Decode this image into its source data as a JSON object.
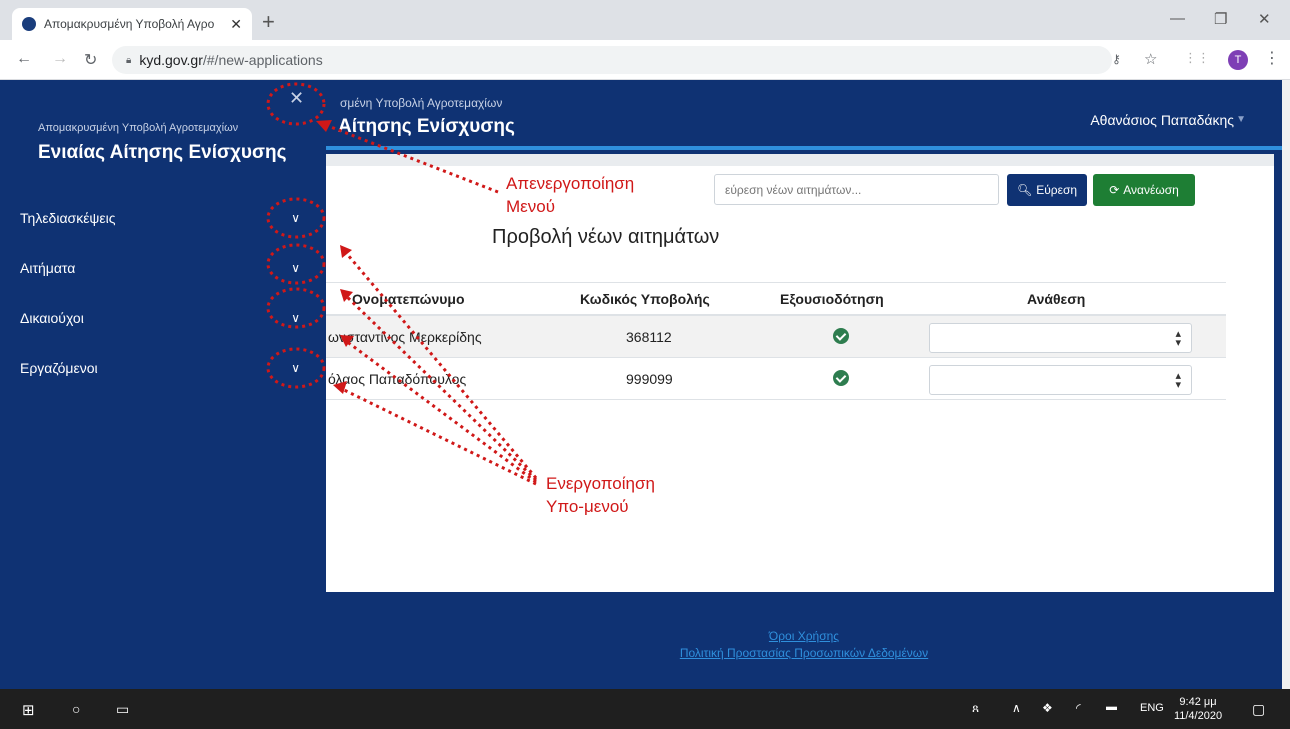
{
  "browser": {
    "tab_title": "Απομακρυσμένη Υποβολή Αγρο",
    "tab_close": "✕",
    "new_tab": "+",
    "url_domain": "kyd.gov.gr",
    "url_path": "/#/new-applications",
    "profile_initial": "T"
  },
  "sidebar": {
    "small_title": "Απομακρυσμένη Υποβολή Αγροτεμαχίων",
    "big_title": "Ενιαίας Αίτησης Ενίσχυσης",
    "close": "✕",
    "items": [
      {
        "label": "Τηλεδιασκέψεις"
      },
      {
        "label": "Αιτήματα"
      },
      {
        "label": "Δικαιούχοι"
      },
      {
        "label": "Εργαζόμενοι"
      }
    ]
  },
  "header": {
    "small_title": "σμένη Υποβολή Αγροτεμαχίων",
    "big_title": "Αίτησης Ενίσχυσης",
    "user": "Αθανάσιος Παπαδάκης"
  },
  "main": {
    "search_placeholder": "εύρεση νέων αιτημάτων...",
    "search_button": "Εύρεση",
    "refresh_button": "Ανανέωση",
    "title": "Προβολή νέων αιτημάτων",
    "columns": [
      "Ονοματεπώνυμο",
      "Κωδικός Υποβολής",
      "Εξουσιοδότηση",
      "Ανάθεση"
    ],
    "rows": [
      {
        "name": "ωνσταντίνος Μερκερίδης",
        "code": "368112",
        "authorized": true
      },
      {
        "name": "όλαος Παπαδόπουλος",
        "code": "999099",
        "authorized": true
      }
    ]
  },
  "footer": {
    "terms": "Όροι Χρήσης",
    "privacy": "Πολιτική Προστασίας Προσωπικών Δεδομένων"
  },
  "annotations": {
    "deactivate_line1": "Απενεργοποίηση",
    "deactivate_line2": "Μενού",
    "activate_line1": "Ενεργοποίηση",
    "activate_line2": "Υπο-μενού",
    "color": "#d01818"
  },
  "taskbar": {
    "lang": "ENG",
    "time": "9:42 μμ",
    "date": "11/4/2020"
  },
  "colors": {
    "navy": "#0f3273",
    "accent_blue": "#2f8fdc",
    "green": "#1e7e34"
  }
}
